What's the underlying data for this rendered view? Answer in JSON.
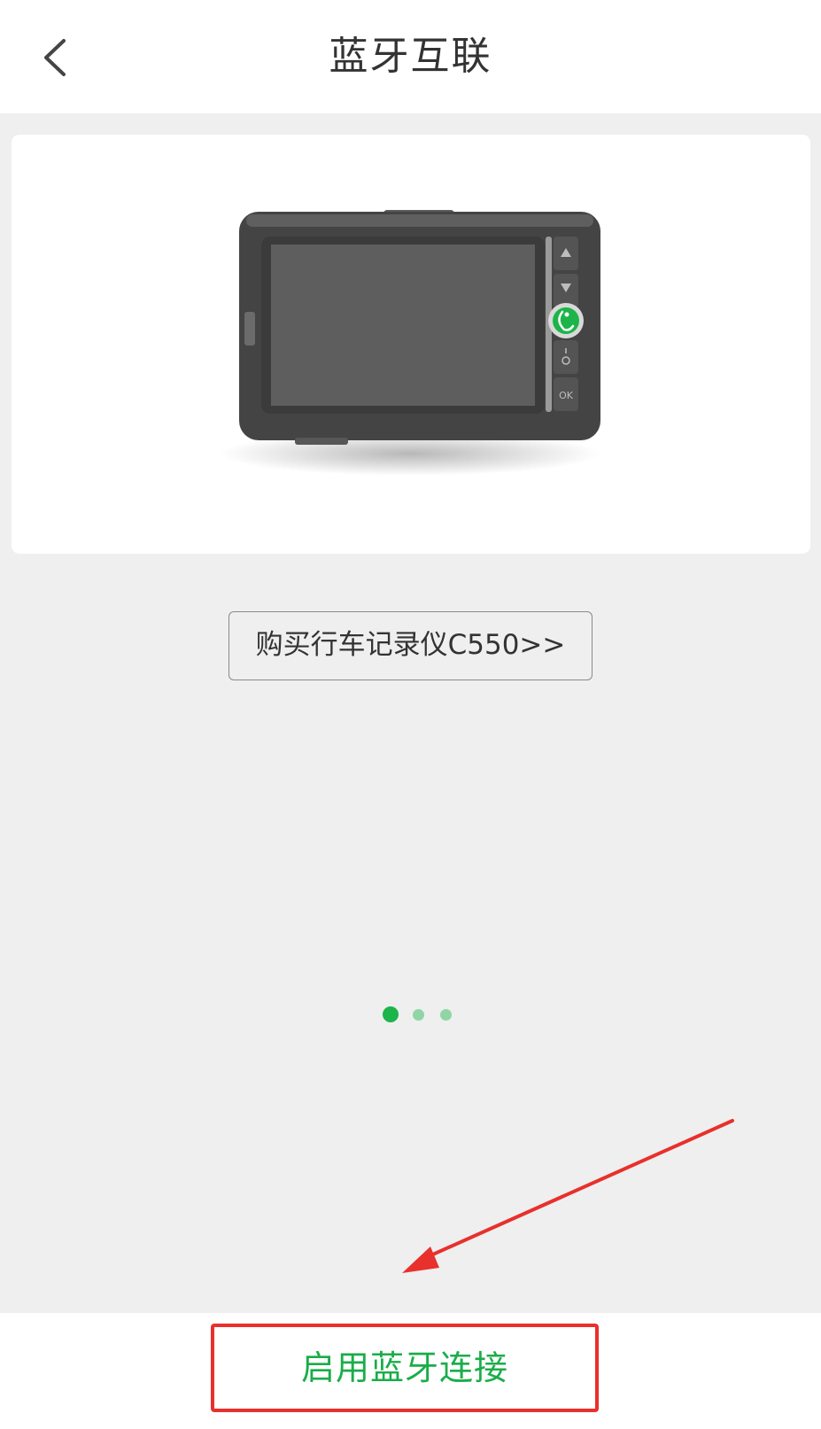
{
  "header": {
    "title": "蓝牙互联",
    "back_icon": "chevron-left-icon"
  },
  "device": {
    "icon": "dashcam-device-illustration",
    "buttons": [
      "▲",
      "▼",
      "OK"
    ]
  },
  "buy_button": {
    "label": "购买行车记录仪C550>>"
  },
  "pager": {
    "count": 3,
    "active_index": 0
  },
  "footer": {
    "enable_label": "启用蓝牙连接"
  },
  "colors": {
    "accent": "#1db44a",
    "accent_light": "#8fd6a4",
    "annotation_red": "#e8302c",
    "title_text": "#333333",
    "enable_text": "#1aad49"
  }
}
